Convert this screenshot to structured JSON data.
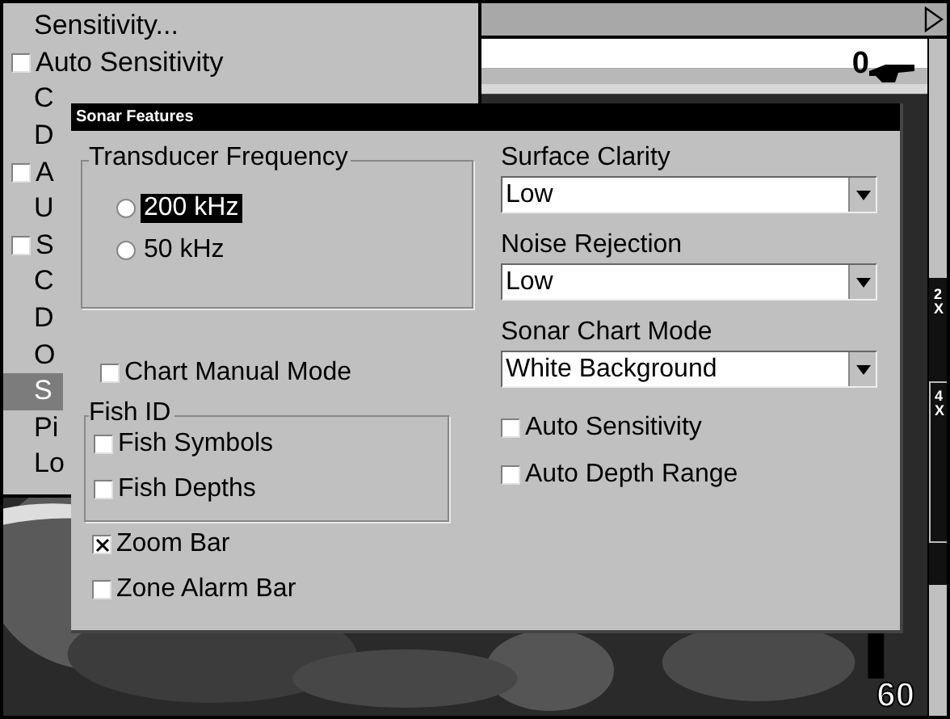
{
  "menu": {
    "items": [
      {
        "label": "Sensitivity...",
        "kind": "plain",
        "selected": false
      },
      {
        "label": "Auto Sensitivity",
        "kind": "check",
        "checked": false,
        "selected": false
      },
      {
        "label": "C",
        "kind": "plain",
        "selected": false
      },
      {
        "label": "D",
        "kind": "plain",
        "selected": false
      },
      {
        "label": "A",
        "kind": "check",
        "checked": false,
        "selected": false
      },
      {
        "label": "U",
        "kind": "plain",
        "selected": false
      },
      {
        "label": "S",
        "kind": "check",
        "checked": false,
        "selected": false
      },
      {
        "label": "C",
        "kind": "plain",
        "selected": false
      },
      {
        "label": "D",
        "kind": "plain",
        "selected": false
      },
      {
        "label": "O",
        "kind": "plain",
        "selected": false
      },
      {
        "label": "S",
        "kind": "plain",
        "selected": true
      },
      {
        "label": "Pi",
        "kind": "plain",
        "selected": false
      },
      {
        "label": "Lo",
        "kind": "plain",
        "selected": false
      }
    ]
  },
  "sonar": {
    "top_depth": "0",
    "bottom_depth": "60",
    "zoom_labels": [
      "2X",
      "4X"
    ]
  },
  "dialog": {
    "title": "Sonar Features",
    "frequency": {
      "label": "Transducer Frequency",
      "options": [
        {
          "label": "200 kHz",
          "selected": true
        },
        {
          "label": "50 kHz",
          "selected": false
        }
      ]
    },
    "chart_manual_mode": {
      "label": "Chart Manual Mode",
      "checked": false
    },
    "fish_id": {
      "label": "Fish ID",
      "options": [
        {
          "label": "Fish Symbols",
          "checked": false
        },
        {
          "label": "Fish Depths",
          "checked": false
        }
      ]
    },
    "left_checks": [
      {
        "label": "Zoom Bar",
        "checked": true
      },
      {
        "label": "Zone Alarm Bar",
        "checked": false
      }
    ],
    "dropdowns": [
      {
        "label": "Surface Clarity",
        "value": "Low"
      },
      {
        "label": "Noise Rejection",
        "value": "Low"
      },
      {
        "label": "Sonar Chart Mode",
        "value": "White Background"
      }
    ],
    "right_checks": [
      {
        "label": "Auto Sensitivity",
        "checked": false
      },
      {
        "label": "Auto Depth Range",
        "checked": false
      }
    ]
  }
}
